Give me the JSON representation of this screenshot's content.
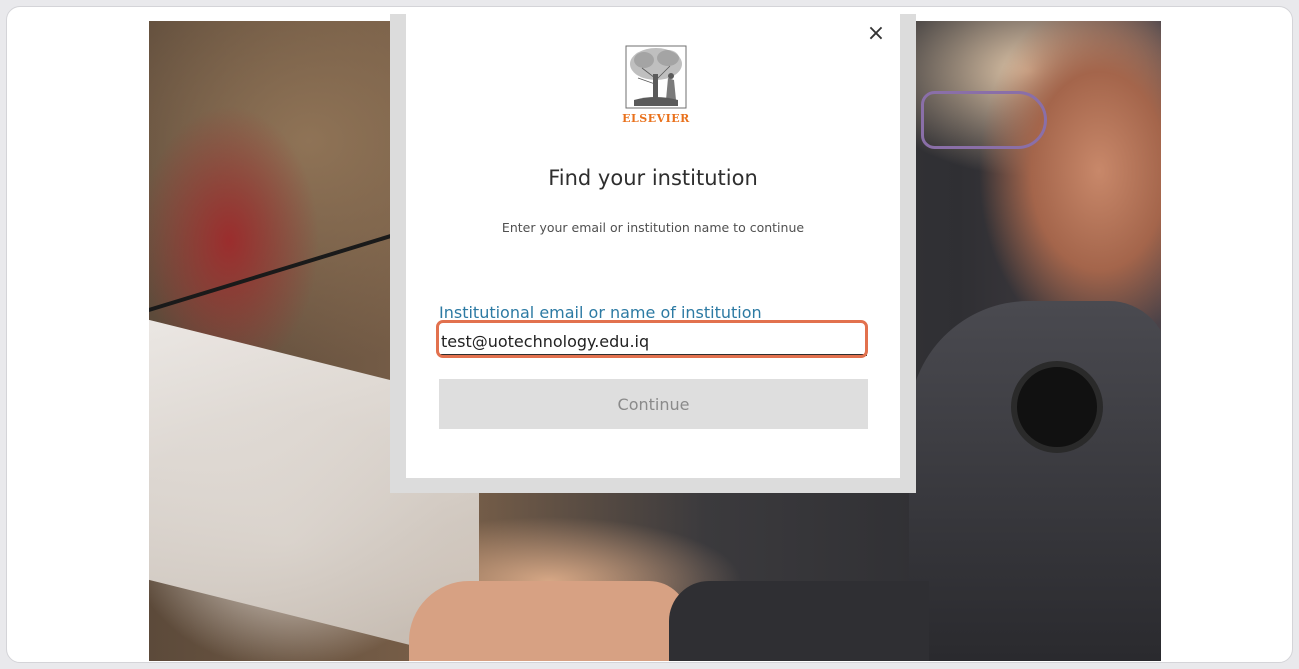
{
  "modal": {
    "close_glyph": "×",
    "logo": {
      "icon": "elsevier-tree-icon",
      "wordmark": "ELSEVIER",
      "color": "#e9711c"
    },
    "title": "Find your institution",
    "subtitle": "Enter your email or institution name to continue",
    "field": {
      "label": "Institutional email or name of institution",
      "value": "test@uotechnology.edu.iq",
      "label_color": "#2c7aa3"
    },
    "continue_label": "Continue",
    "highlight_color": "#e2714e"
  }
}
